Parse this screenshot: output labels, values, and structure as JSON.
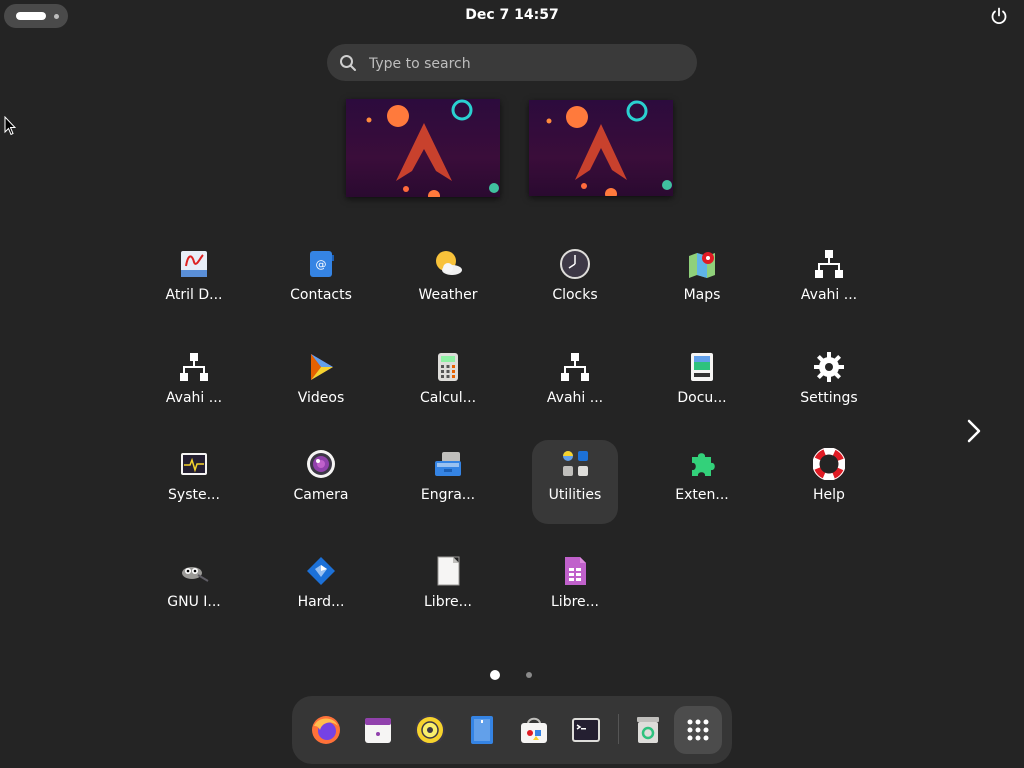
{
  "topbar": {
    "clock": "Dec 7  14:57"
  },
  "search": {
    "placeholder": "Type to search"
  },
  "apps": [
    {
      "label": "Atril D...",
      "icon": "atril-document-viewer-icon"
    },
    {
      "label": "Contacts",
      "icon": "contacts-icon"
    },
    {
      "label": "Weather",
      "icon": "weather-icon"
    },
    {
      "label": "Clocks",
      "icon": "clocks-icon"
    },
    {
      "label": "Maps",
      "icon": "maps-icon"
    },
    {
      "label": "Avahi ...",
      "icon": "network-icon"
    },
    {
      "label": "Avahi ...",
      "icon": "network-icon"
    },
    {
      "label": "Videos",
      "icon": "videos-icon"
    },
    {
      "label": "Calcul...",
      "icon": "calculator-icon"
    },
    {
      "label": "Avahi ...",
      "icon": "network-icon"
    },
    {
      "label": "Docu...",
      "icon": "document-scanner-icon"
    },
    {
      "label": "Settings",
      "icon": "gear-icon"
    },
    {
      "label": "Syste...",
      "icon": "system-monitor-icon"
    },
    {
      "label": "Camera",
      "icon": "camera-icon"
    },
    {
      "label": "Engra...",
      "icon": "engrampa-archive-icon"
    },
    {
      "label": "Utilities",
      "icon": "utilities-folder-icon"
    },
    {
      "label": "Exten...",
      "icon": "extensions-puzzle-icon"
    },
    {
      "label": "Help",
      "icon": "help-lifebuoy-icon"
    },
    {
      "label": "GNU I...",
      "icon": "gimp-icon"
    },
    {
      "label": "Hard...",
      "icon": "hardinfo-icon"
    },
    {
      "label": "Libre...",
      "icon": "libreoffice-icon"
    },
    {
      "label": "Libre...",
      "icon": "libreoffice-calc-icon"
    }
  ],
  "pagination": {
    "pages": 2,
    "current": 1
  },
  "dock": [
    {
      "icon": "firefox-icon"
    },
    {
      "icon": "calendar-icon"
    },
    {
      "icon": "rhythmbox-icon"
    },
    {
      "icon": "text-editor-icon"
    },
    {
      "icon": "software-store-icon"
    },
    {
      "icon": "terminal-icon"
    },
    {
      "icon": "trash-icon"
    },
    {
      "icon": "app-grid-icon"
    }
  ],
  "colors": {
    "background": "#242424",
    "dock": "#363636",
    "search": "#3a3a3a"
  }
}
